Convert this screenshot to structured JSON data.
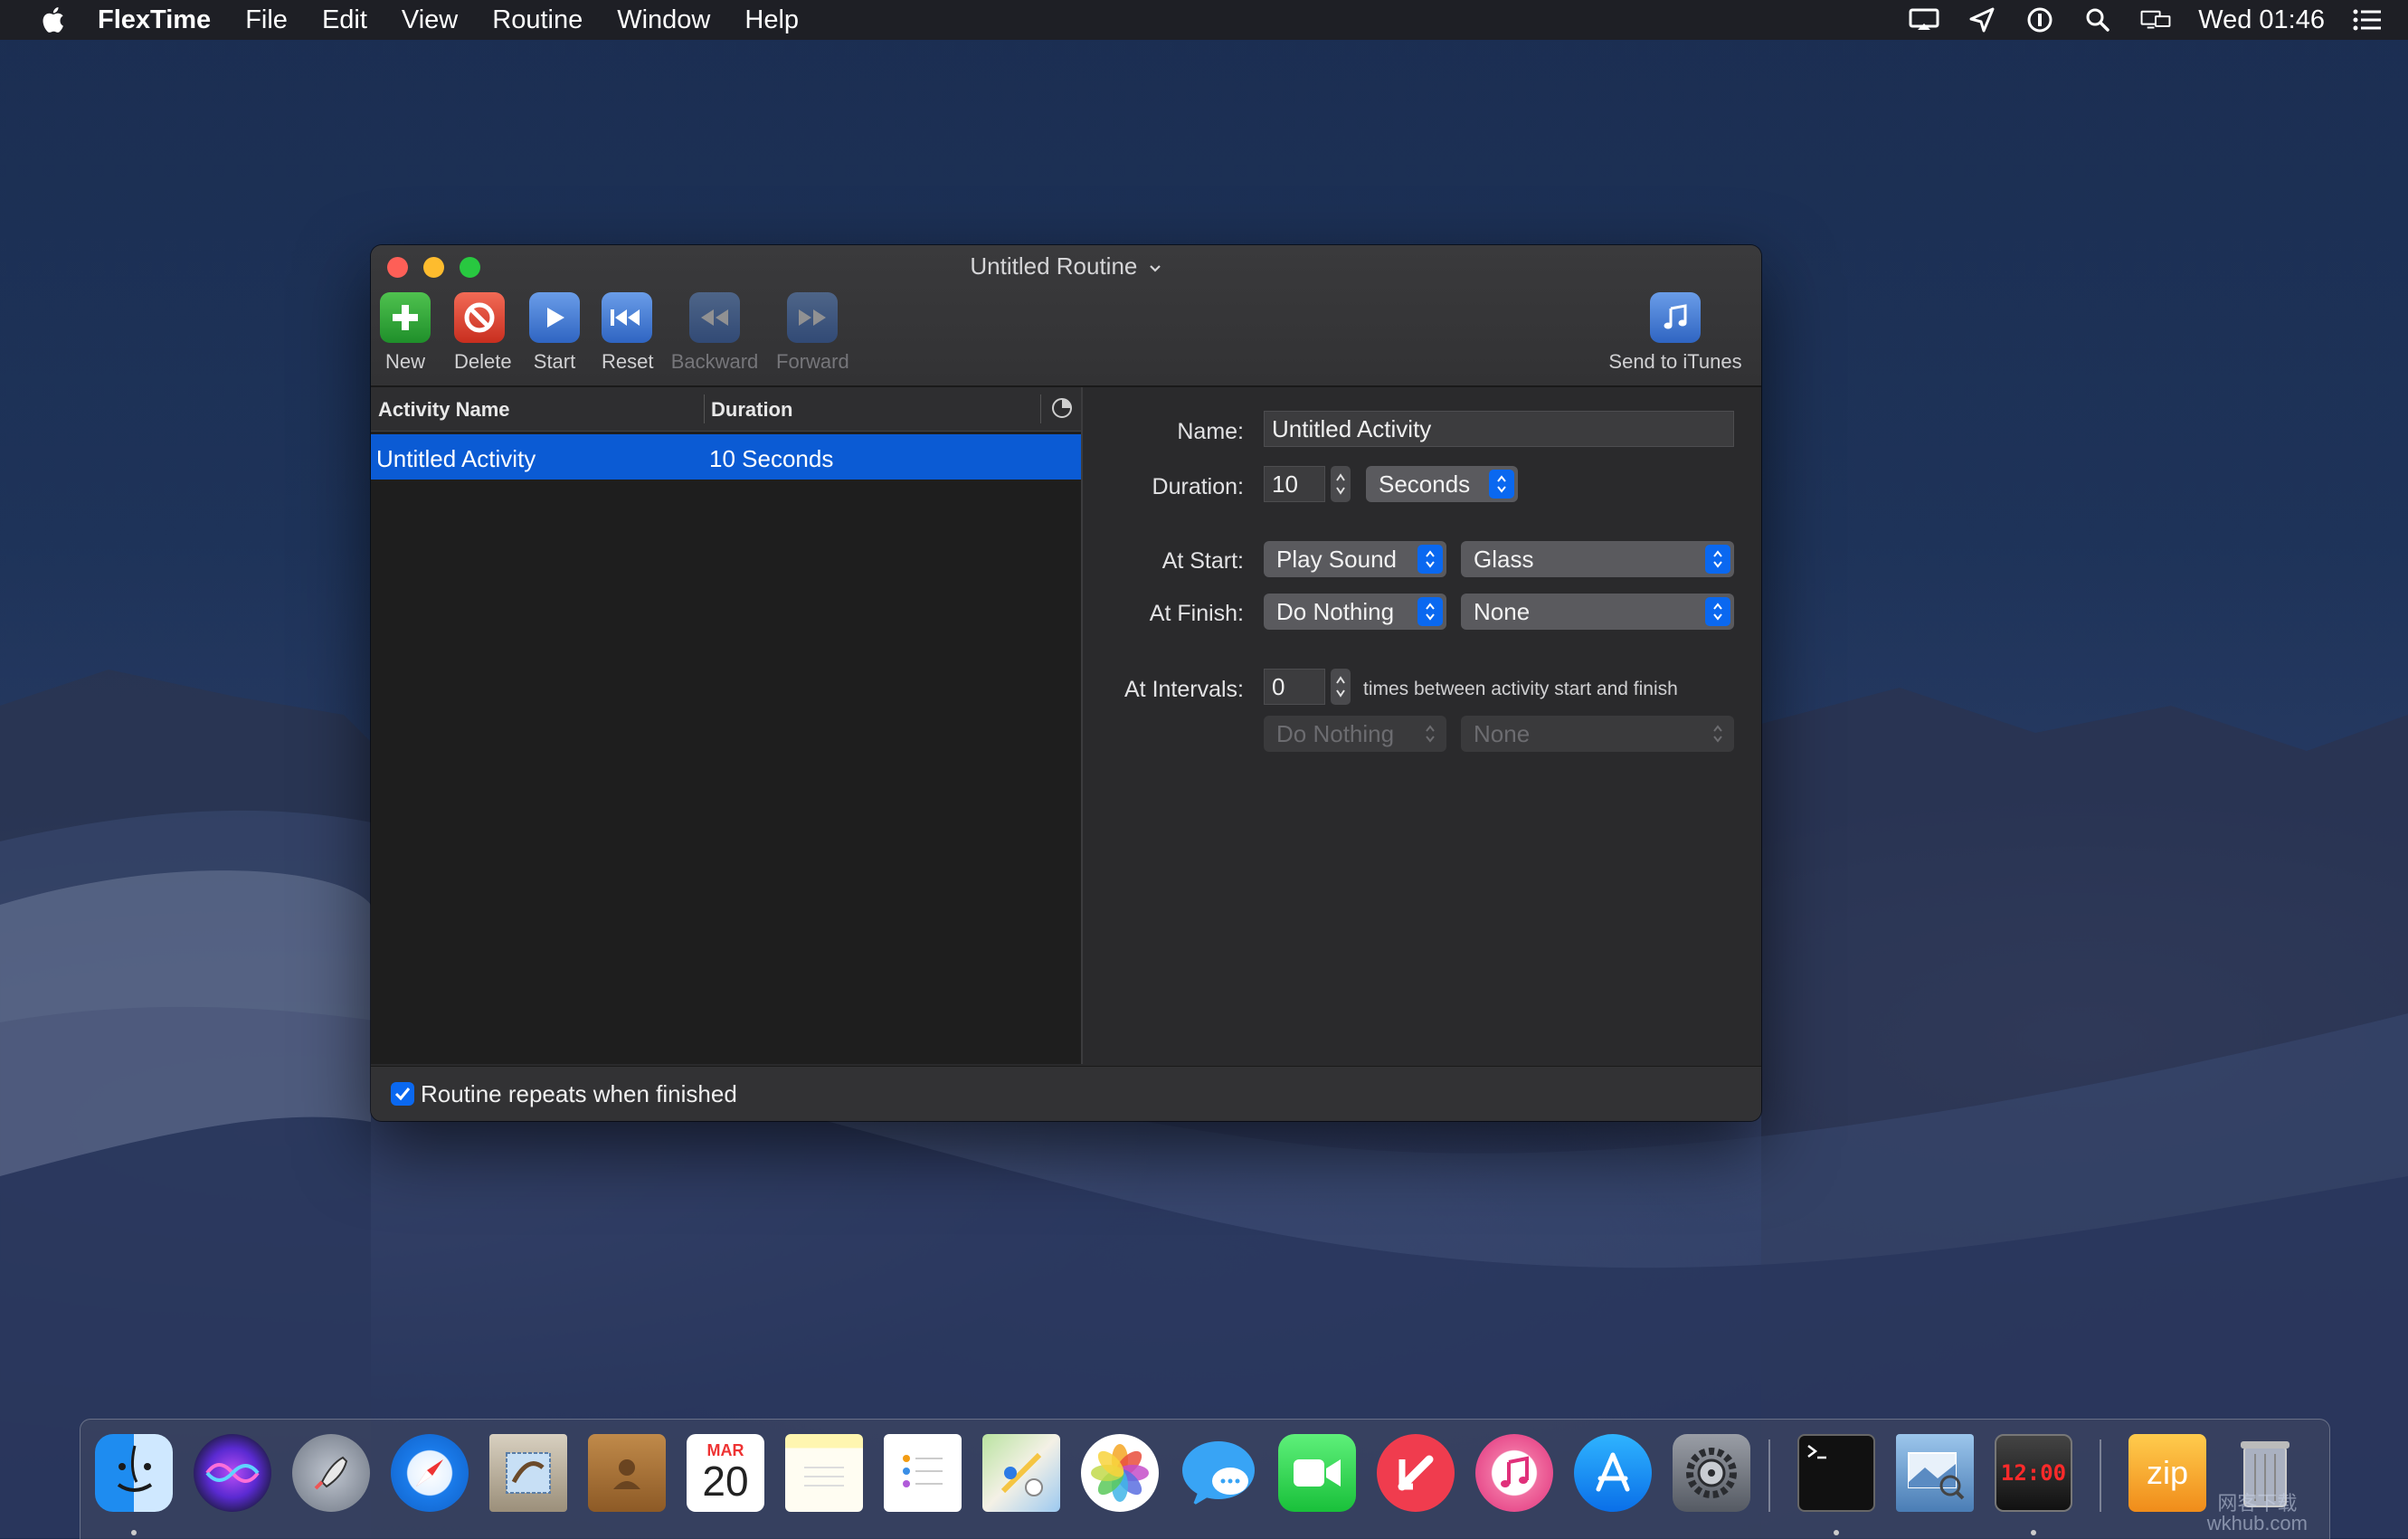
{
  "menubar": {
    "app_name": "FlexTime",
    "items": [
      "File",
      "Edit",
      "View",
      "Routine",
      "Window",
      "Help"
    ],
    "clock": "Wed 01:46"
  },
  "window": {
    "title": "Untitled Routine",
    "toolbar": {
      "new": "New",
      "delete": "Delete",
      "start": "Start",
      "reset": "Reset",
      "backward": "Backward",
      "forward": "Forward",
      "send_to_itunes": "Send to iTunes"
    },
    "table": {
      "col_name": "Activity Name",
      "col_duration": "Duration",
      "rows": [
        {
          "name": "Untitled Activity",
          "duration": "10 Seconds"
        }
      ]
    },
    "detail": {
      "name_label": "Name:",
      "name_value": "Untitled Activity",
      "duration_label": "Duration:",
      "duration_value": "10",
      "duration_unit": "Seconds",
      "at_start_label": "At Start:",
      "at_start_action": "Play Sound",
      "at_start_sound": "Glass",
      "at_finish_label": "At Finish:",
      "at_finish_action": "Do Nothing",
      "at_finish_sound": "None",
      "at_intervals_label": "At Intervals:",
      "at_intervals_value": "0",
      "at_intervals_note": "times between activity start and finish",
      "interval_action": "Do Nothing",
      "interval_sound": "None"
    },
    "repeat_checkbox": {
      "label": "Routine repeats when finished",
      "checked": true
    }
  },
  "dock": {
    "calendar_month": "MAR",
    "calendar_day": "20",
    "archive_label": "zip",
    "clock_app_time": "12:00"
  },
  "watermark": {
    "line1": "网客下载",
    "line2": "wkhub.com"
  },
  "colors": {
    "accent": "#0a68f0",
    "selection": "#0b5bd4"
  }
}
